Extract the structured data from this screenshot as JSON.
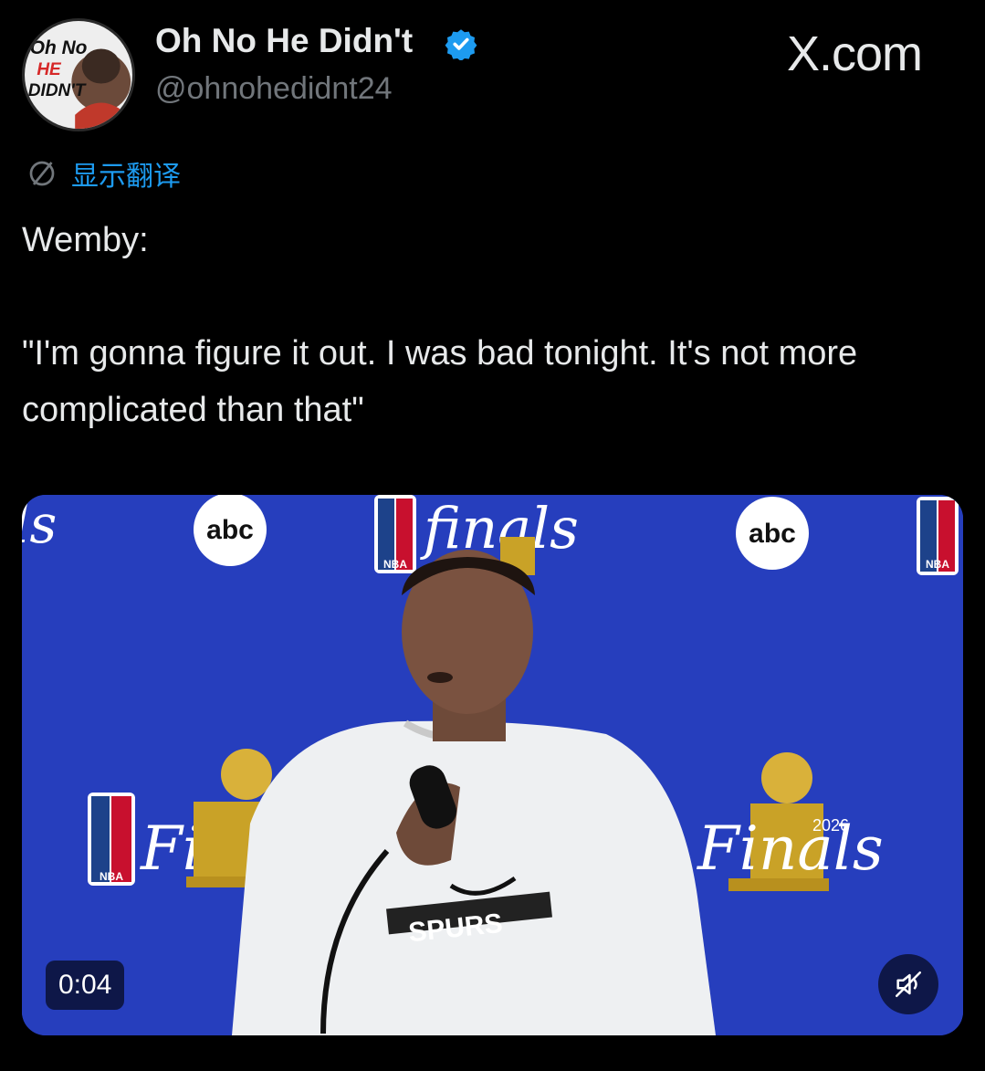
{
  "author": {
    "display_name": "Oh No He Didn't",
    "handle": "@ohnohedidnt24",
    "avatar_text": "Oh No HE DIDN'T"
  },
  "header": {
    "site_label": "X.com"
  },
  "post": {
    "translate_label": "显示翻译",
    "text": "Wemby:\n\n\"I'm gonna figure it out. I was bad tonight. It's not more complicated than that\""
  },
  "video": {
    "timestamp": "0:04",
    "backdrop_logos": [
      "abc",
      "NBA",
      "Finals",
      "2026"
    ],
    "shirt_text": "SPURS"
  },
  "colors": {
    "background": "#000000",
    "text": "#e7e9ea",
    "secondary": "#71767b",
    "link": "#1d9bf0",
    "verified": "#1d9bf0",
    "backdrop_blue": "#2a43c6"
  },
  "icons": [
    "verified-badge-icon",
    "translate-globe-icon",
    "mute-icon"
  ]
}
